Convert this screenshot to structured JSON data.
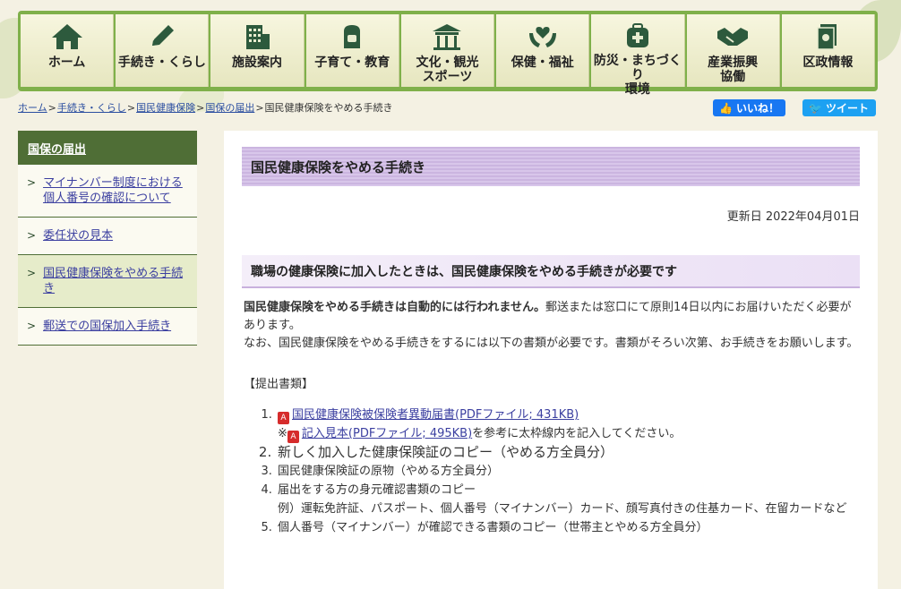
{
  "nav": [
    {
      "label": "ホーム",
      "icon": "home-icon"
    },
    {
      "label": "手続き・くらし",
      "icon": "pencil-icon"
    },
    {
      "label": "施設案内",
      "icon": "building-icon"
    },
    {
      "label": "子育て・教育",
      "icon": "backpack-icon"
    },
    {
      "label": "文化・観光\nスポーツ",
      "icon": "shrine-icon"
    },
    {
      "label": "保健・福祉",
      "icon": "heart-hands-icon"
    },
    {
      "label": "防災・まちづくり\n環境",
      "icon": "emergency-bag-icon"
    },
    {
      "label": "産業振興\n協働",
      "icon": "handshake-icon"
    },
    {
      "label": "区政情報",
      "icon": "document-icon"
    }
  ],
  "breadcrumb": {
    "items": [
      "ホーム",
      "手続き・くらし",
      "国民健康保険",
      "国保の届出"
    ],
    "current": "国民健康保険をやめる手続き",
    "separator": ">"
  },
  "social": {
    "like": "いいね！",
    "tweet": "ツイート"
  },
  "sidebar": {
    "heading": "国保の届出",
    "items": [
      {
        "label": "マイナンバー制度における個人番号の確認について"
      },
      {
        "label": "委任状の見本"
      },
      {
        "label": "国民健康保険をやめる手続き"
      },
      {
        "label": "郵送での国保加入手続き"
      }
    ]
  },
  "main": {
    "title": "国民健康保険をやめる手続き",
    "updated": "更新日 2022年04月01日",
    "section_heading": "職場の健康保険に加入したときは、国民健康保険をやめる手続きが必要です",
    "para1_bold": "国民健康保険をやめる手続きは自動的には行われません。",
    "para1_rest": "郵送または窓口にて原則14日以内にお届けいただく必要があります。",
    "para2": "なお、国民健康保険をやめる手続きをするには以下の書類が必要です。書類がそろい次第、お手続きをお願いします。",
    "docs_heading": "【提出書類】",
    "doc1_link": "国民健康保険被保険者異動届書(PDFファイル; 431KB)",
    "doc1_note_prefix": "※",
    "doc1_note_link": "記入見本(PDFファイル; 495KB)",
    "doc1_note_rest": "を参考に太枠線内を記入してください。",
    "doc2": "新しく加入した健康保険証のコピー（やめる方全員分）",
    "doc3": "国民健康保険証の原物（やめる方全員分）",
    "doc4": "届出をする方の身元確認書類のコピー",
    "doc4_example": "例）運転免許証、パスポート、個人番号（マイナンバー）カード、顔写真付きの住基カード、在留カードなど",
    "doc5": "個人番号（マイナンバー）が確認できる書類のコピー（世帯主とやめる方全員分）"
  },
  "colors": {
    "nav_green": "#7fb04a",
    "sidebar_green": "#4f6e36",
    "heading_purple": "#cbb5e0",
    "link": "#3b3fa0"
  }
}
